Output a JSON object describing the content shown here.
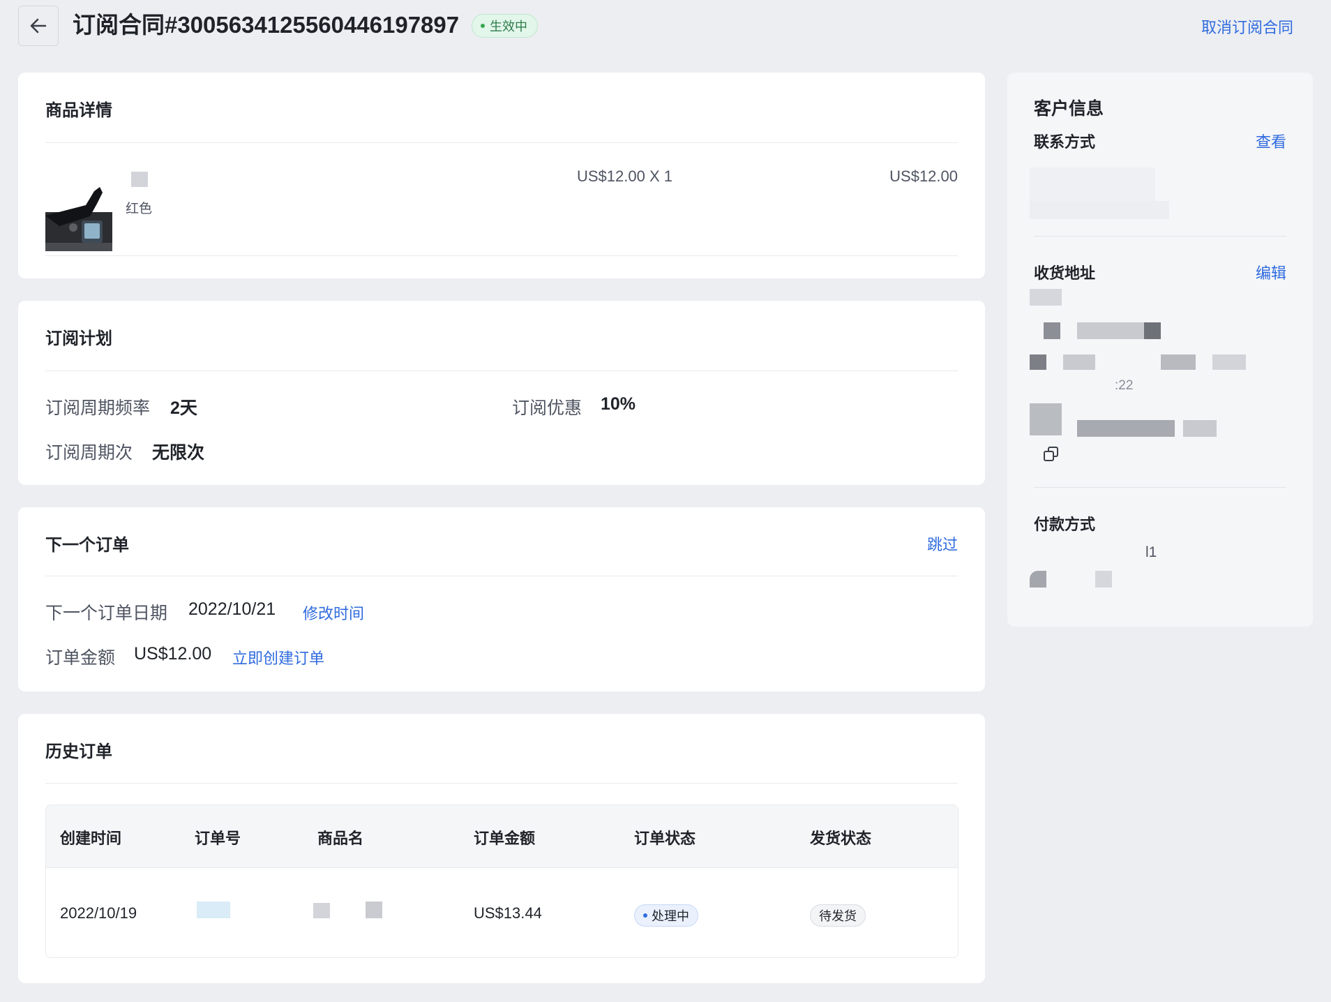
{
  "header": {
    "title": "订阅合同#3005634125560446197897",
    "status": "生效中",
    "cancel_label": "取消订阅合同"
  },
  "product": {
    "title": "商品详情",
    "variant": "红色",
    "price_qty": "US$12.00 X 1",
    "total": "US$12.00"
  },
  "plan": {
    "title": "订阅计划",
    "frequency_label": "订阅周期频率",
    "frequency_value": "2天",
    "discount_label": "订阅优惠",
    "discount_value": "10%",
    "cycles_label": "订阅周期次",
    "cycles_value": "无限次"
  },
  "next_order": {
    "title": "下一个订单",
    "skip_label": "跳过",
    "date_label": "下一个订单日期",
    "date_value": "2022/10/21",
    "change_time_label": "修改时间",
    "amount_label": "订单金额",
    "amount_value": "US$12.00",
    "create_now_label": "立即创建订单"
  },
  "history": {
    "title": "历史订单",
    "columns": [
      "创建时间",
      "订单号",
      "商品名",
      "订单金额",
      "订单状态",
      "发货状态"
    ],
    "rows": [
      {
        "created": "2022/10/19",
        "amount": "US$13.44",
        "order_status": "处理中",
        "ship_status": "待发货"
      }
    ]
  },
  "customer": {
    "title": "客户信息",
    "contact_label": "联系方式",
    "contact_action": "查看",
    "address_label": "收货地址",
    "address_action": "编辑",
    "address_fragment": ":22",
    "payment_label": "付款方式",
    "payment_fragment": "l1"
  },
  "colors": {
    "accent": "#2f6bde",
    "success": "#34a853",
    "background": "#eceef2"
  }
}
